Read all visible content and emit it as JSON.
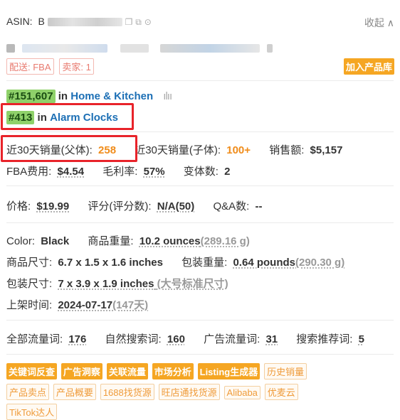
{
  "asin": {
    "label": "ASIN:",
    "value_prefix": "B",
    "collapse": "收起"
  },
  "tags": {
    "fulfillment": "配送: FBA",
    "sellers": "卖家: 1",
    "add_to_library": "加入产品库"
  },
  "ranks": [
    {
      "rank": "#151,607",
      "in": "in",
      "category": "Home & Kitchen"
    },
    {
      "rank": "#413",
      "in": "in",
      "category": "Alarm Clocks"
    }
  ],
  "sales": {
    "parent_label": "近30天销量(父体):",
    "parent_value": "258",
    "child_label": "近30天销量(子体):",
    "child_value": "100+",
    "revenue_label": "销售额:",
    "revenue_value": "$5,157",
    "fba_label": "FBA费用:",
    "fba_value": "$4.54",
    "margin_label": "毛利率:",
    "margin_value": "57%",
    "variants_label": "变体数:",
    "variants_value": "2"
  },
  "pricing": {
    "price_label": "价格:",
    "price_value": "$19.99",
    "rating_label": "评分(评分数):",
    "rating_value": "N/A(50)",
    "qa_label": "Q&A数:",
    "qa_value": "--"
  },
  "specs": {
    "color_label": "Color:",
    "color_value": "Black",
    "weight_label": "商品重量:",
    "weight_value": "10.2 ounces",
    "weight_alt": "(289.16 g)",
    "size_label": "商品尺寸:",
    "size_value": "6.7 x 1.5 x 1.6 inches",
    "pkg_weight_label": "包装重量:",
    "pkg_weight_value": "0.64 pounds",
    "pkg_weight_alt": "(290.30 g)",
    "pkg_size_label": "包装尺寸:",
    "pkg_size_value": "7 x 3.9 x 1.9 inches",
    "pkg_size_alt": "(大号标准尺寸)",
    "listed_label": "上架时间:",
    "listed_value": "2024-07-17",
    "listed_alt": "(147天)"
  },
  "keywords": {
    "all_label": "全部流量词:",
    "all_value": "176",
    "organic_label": "自然搜索词:",
    "organic_value": "160",
    "ad_label": "广告流量词:",
    "ad_value": "31",
    "rec_label": "搜索推荐词:",
    "rec_value": "5"
  },
  "tools": {
    "solid": [
      "关键词反查",
      "广告洞察",
      "关联流量",
      "市场分析",
      "Listing生成器"
    ],
    "outline_row1": [
      "历史销量"
    ],
    "outline_row2": [
      "产品卖点",
      "产品概要",
      "1688找货源",
      "旺店通找货源",
      "Alibaba",
      "优麦云"
    ],
    "outline_row3": [
      "TikTok达人"
    ]
  },
  "colors": {
    "accent": "#f5a623",
    "rank_green": "#8fd16a",
    "link_blue": "#1c6fb5",
    "highlight_red": "#e8232a"
  },
  "icons": [
    "copy-icon",
    "copy-alt-icon",
    "location-icon",
    "chevron-up-icon",
    "bar-chart-icon"
  ]
}
